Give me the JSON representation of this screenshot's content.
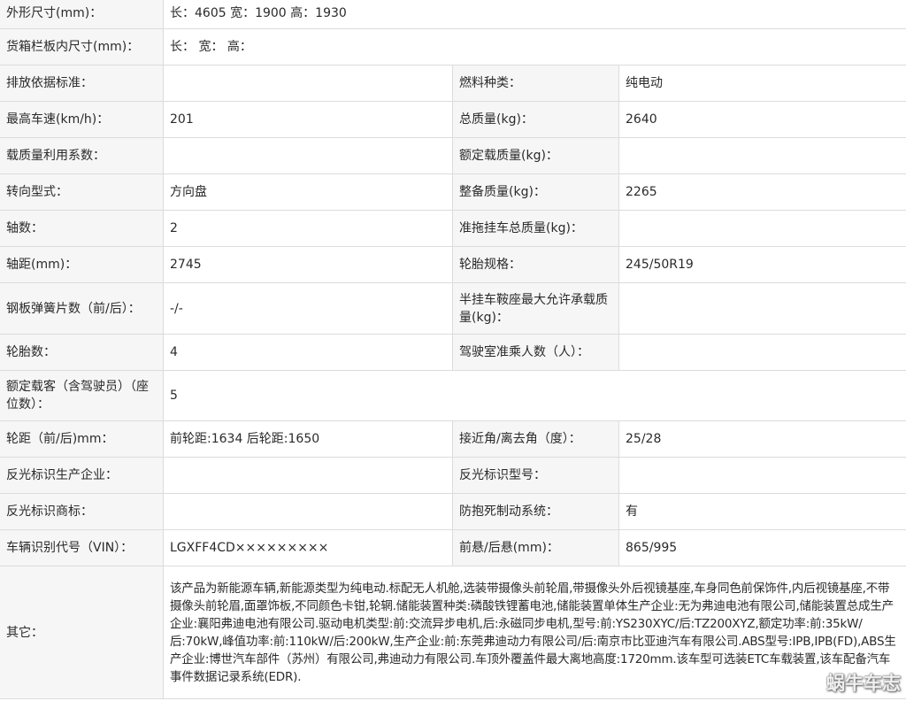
{
  "rows": {
    "dimensions": {
      "label": "外形尺寸(mm)：",
      "value": "长：4605 宽：1900 高：1930"
    },
    "cargo_box": {
      "label": "货箱栏板内尺寸(mm)：",
      "value": "长：  宽：  高："
    },
    "emission_std": {
      "label": "排放依据标准：",
      "value": ""
    },
    "fuel_type": {
      "label": "燃料种类：",
      "value": "纯电动"
    },
    "max_speed": {
      "label": "最高车速(km/h)：",
      "value": "201"
    },
    "total_mass": {
      "label": "总质量(kg)：",
      "value": "2640"
    },
    "load_coeff": {
      "label": "载质量利用系数：",
      "value": ""
    },
    "rated_load": {
      "label": "额定载质量(kg)：",
      "value": ""
    },
    "steering": {
      "label": "转向型式：",
      "value": "方向盘"
    },
    "curb_mass": {
      "label": "整备质量(kg)：",
      "value": "2265"
    },
    "axles": {
      "label": "轴数：",
      "value": "2"
    },
    "trailer_mass": {
      "label": "准拖挂车总质量(kg)：",
      "value": ""
    },
    "wheelbase": {
      "label": "轴距(mm)：",
      "value": "2745"
    },
    "tire_spec": {
      "label": "轮胎规格：",
      "value": "245/50R19"
    },
    "leaf_springs": {
      "label": "钢板弹簧片数（前/后）：",
      "value": "-/-"
    },
    "fifth_wheel": {
      "label": "半挂车鞍座最大允许承载质量(kg)：",
      "value": ""
    },
    "tires": {
      "label": "轮胎数：",
      "value": "4"
    },
    "cab_passengers": {
      "label": "驾驶室准乘人数（人）：",
      "value": ""
    },
    "seats": {
      "label": "额定载客（含驾驶员）（座位数）：",
      "value": "5"
    },
    "track": {
      "label": "轮距（前/后)mm：",
      "value": "前轮距:1634 后轮距:1650"
    },
    "angles": {
      "label": "接近角/离去角（度）：",
      "value": "25/28"
    },
    "reflector_maker": {
      "label": "反光标识生产企业：",
      "value": ""
    },
    "reflector_model": {
      "label": "反光标识型号：",
      "value": ""
    },
    "reflector_brand": {
      "label": "反光标识商标：",
      "value": ""
    },
    "abs": {
      "label": "防抱死制动系统：",
      "value": "有"
    },
    "vin": {
      "label": "车辆识别代号（VIN）：",
      "value": "LGXFF4CD×××××××××"
    },
    "overhang": {
      "label": "前悬/后悬(mm)：",
      "value": "865/995"
    },
    "other": {
      "label": "其它：",
      "value": "该产品为新能源车辆,新能源类型为纯电动.标配无人机舱,选装带摄像头前轮眉,带摄像头外后视镜基座,车身同色前保饰件,内后视镜基座,不带摄像头前轮眉,面罩饰板,不同颜色卡钳,轮辋.储能装置种类:磷酸铁锂蓄电池,储能装置单体生产企业:无为弗迪电池有限公司,储能装置总成生产企业:襄阳弗迪电池有限公司.驱动电机类型:前:交流异步电机,后:永磁同步电机,型号:前:YS230XYC/后:TZ200XYZ,额定功率:前:35kW/后:70kW,峰值功率:前:110kW/后:200kW,生产企业:前:东莞弗迪动力有限公司/后:南京市比亚迪汽车有限公司.ABS型号:IPB,IPB(FD),ABS生产企业:博世汽车部件（苏州）有限公司,弗迪动力有限公司.车顶外覆盖件最大离地高度:1720mm.该车型可选装ETC车载装置,该车配备汽车事件数据记录系统(EDR)."
    }
  },
  "watermark": {
    "text": "蜗牛车志",
    "icon": "weibo-icon"
  }
}
